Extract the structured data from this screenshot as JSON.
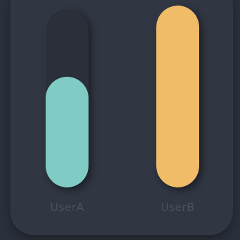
{
  "colors": {
    "background": "#2b313c",
    "card": "#303642",
    "track": "#2a2f39",
    "label": "#4a5160"
  },
  "bars": [
    {
      "label": "UserA",
      "fraction": 0.62,
      "color": "#80cbc4"
    },
    {
      "label": "UserB",
      "fraction": 1.0,
      "color": "#f0bc68"
    }
  ]
}
